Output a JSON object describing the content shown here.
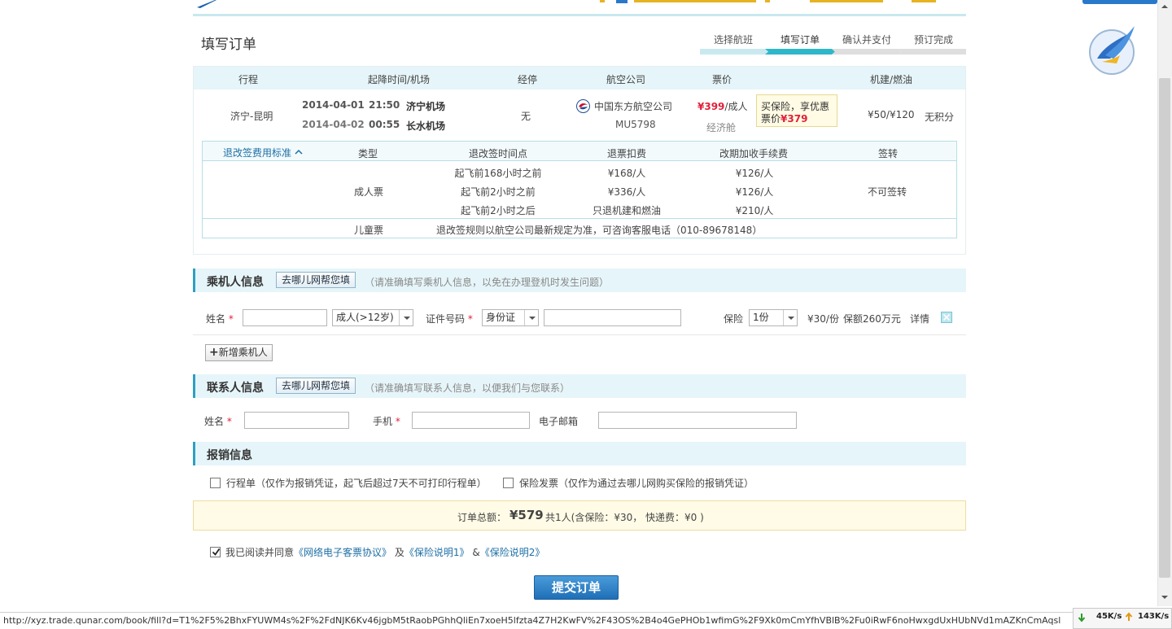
{
  "header": {
    "page_title": "填写订单",
    "steps": [
      {
        "label": "选择航班",
        "state": "done"
      },
      {
        "label": "填写订单",
        "state": "active"
      },
      {
        "label": "确认并支付",
        "state": "todo"
      },
      {
        "label": "预订完成",
        "state": "todo"
      }
    ]
  },
  "flight": {
    "columns": [
      "行程",
      "起降时间/机场",
      "经停",
      "航空公司",
      "票价",
      "机建/燃油"
    ],
    "route": "济宁-昆明",
    "dep_date": "2014-04-01",
    "dep_time": "21:50",
    "dep_airport": "济宁机场",
    "arr_date": "2014-04-02",
    "arr_time": "00:55",
    "arr_airport": "长水机场",
    "stops": "无",
    "airline": "中国东方航空公司",
    "flight_no": "MU5798",
    "price": "¥399",
    "price_unit": "/成人",
    "cabin": "经济舱",
    "tip_line1": "买保险，享优惠",
    "tip_prefix": "票价",
    "tip_price": "¥379",
    "tax_fuel": "¥50/¥120",
    "points": "无积分",
    "colors": {
      "accent": "#2fb7c9",
      "price": "#e0213b",
      "header_bg": "#e6f5f9"
    }
  },
  "rules": {
    "toggle_label": "退改签费用标准",
    "columns": [
      "类型",
      "退改签时间点",
      "退票扣费",
      "改期加收手续费",
      "签转"
    ],
    "adult_label": "成人票",
    "rows": [
      {
        "time": "起飞前168小时之前",
        "refund": "¥168/人",
        "change": "¥126/人"
      },
      {
        "time": "起飞前2小时之前",
        "refund": "¥336/人",
        "change": "¥126/人"
      },
      {
        "time": "起飞前2小时之后",
        "refund": "只退机建和燃油",
        "change": "¥210/人"
      }
    ],
    "transfer": "不可签转",
    "child_label": "儿童票",
    "child_note": "退改签规则以航空公司最新规定为准，可咨询客服电话（010-89678148）"
  },
  "passenger": {
    "section_title": "乘机人信息",
    "help_button": "去哪儿网帮您填",
    "hint": "（请准确填写乘机人信息，以免在办理登机时发生问题）",
    "name_label": "姓名",
    "name_value": "",
    "type_select": "成人(>12岁)",
    "id_label": "证件号码",
    "id_type_select": "身份证",
    "id_value": "",
    "insurance_label": "保险",
    "insurance_select": "1份",
    "insurance_price": "¥30/份",
    "insurance_cover": "保额260万元",
    "details_link": "详情",
    "add_button": "新增乘机人"
  },
  "contact": {
    "section_title": "联系人信息",
    "help_button": "去哪儿网帮您填",
    "hint": "（请准确填写联系人信息，以便我们与您联系）",
    "name_label": "姓名",
    "phone_label": "手机",
    "email_label": "电子邮箱"
  },
  "invoice": {
    "section_title": "报销信息",
    "itinerary_label": "行程单（仅作为报销凭证，起飞后超过7天不可打印行程单）",
    "itinerary_checked": false,
    "insurance_invoice_label": "保险发票（仅作为通过去哪儿网购买保险的报销凭证）",
    "insurance_invoice_checked": false
  },
  "total": {
    "label": "订单总额：",
    "amount": "¥579",
    "detail": "共1人(含保险：¥30， 快递费：¥0 )"
  },
  "agreement": {
    "checked": true,
    "prefix": "我已阅读并同意",
    "link1": "《网络电子客票协议》",
    "and1": "及",
    "link2": "《保险说明1》",
    "and2": "&",
    "link3": "《保险说明2》"
  },
  "submit_label": "提交订单",
  "status_bar": {
    "url": "http://xyz.trade.qunar.com/book/fill?d=T1%2F5%2BhxFYUWM4s%2F%2FdNJK6Kv46jgbM5tRaobPGhhQliEn7xoeH5lfzta4Z7H2KwFV%2F43OS%2B4o4GePHOb1wfimG%2F9Xk0mCmYfhVBlB%2Fu0iRwF6noHwxgdUxHUbNVd1mAZKnCmAqsl",
    "down_speed": "45K/s",
    "up_speed": "143K/s"
  }
}
